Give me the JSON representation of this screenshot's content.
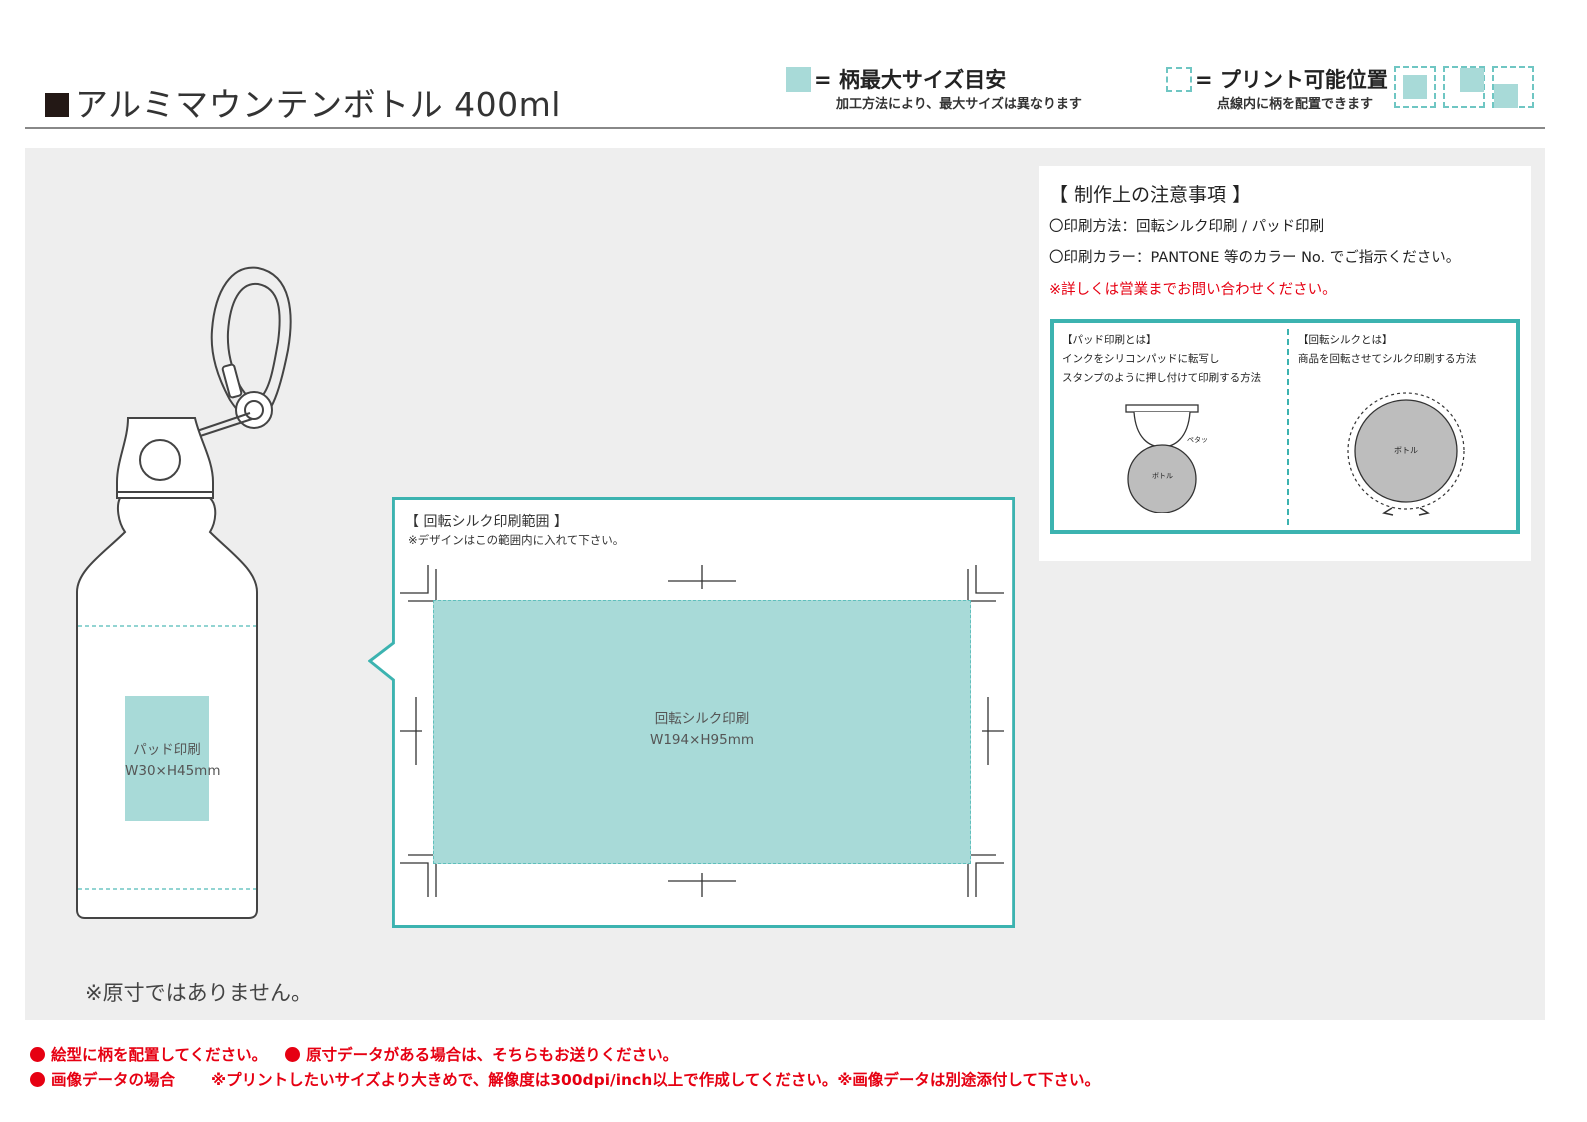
{
  "header": {
    "title": "アルミマウンテンボトル 400ml",
    "legend_max": {
      "label": "= 柄最大サイズ目安",
      "sub": "加工方法により、最大サイズは異なります"
    },
    "legend_position": {
      "label": "= プリント可能位置",
      "sub": "点線内に柄を配置できます"
    }
  },
  "notes": {
    "title": "【 制作上の注意事項 】",
    "method": "〇印刷方法：回転シルク印刷 / パッド印刷",
    "color": "〇印刷カラー：PANTONE 等のカラー No. でご指示ください。",
    "contact": "※詳しくは営業までお問い合わせください。",
    "pad": {
      "heading": "【パッド印刷とは】",
      "line1": "インクをシリコンパッドに転写し",
      "line2": "スタンプのように押し付けて印刷する方法",
      "stamp_label": "ペタッ",
      "bottle_label": "ボトル"
    },
    "silk": {
      "heading": "【回転シルクとは】",
      "line1": "商品を回転させてシルク印刷する方法",
      "bottle_label": "ボトル"
    }
  },
  "silk_range": {
    "heading": "【 回転シルク印刷範囲 】",
    "note": "※デザインはこの範囲内に入れて下さい。",
    "area_name": "回転シルク印刷",
    "area_size": "W194×H95mm"
  },
  "pad_print": {
    "area_name": "パッド印刷",
    "area_size": "W30×H45mm"
  },
  "disclaimer": "※原寸ではありません。",
  "footer": {
    "line1_a": "絵型に柄を配置してください。",
    "line1_b": "原寸データがある場合は、そちらもお送りください。",
    "line2_a": "画像データの場合",
    "line2_b": "※プリントしたいサイズより大きめで、解像度は300dpi/inch以上で作成してください。※画像データは別途添付して下さい。"
  },
  "colors": {
    "teal": "#3cb3b0",
    "swatch": "#a8dad8",
    "red": "#e60012",
    "background": "#eeeeee"
  }
}
